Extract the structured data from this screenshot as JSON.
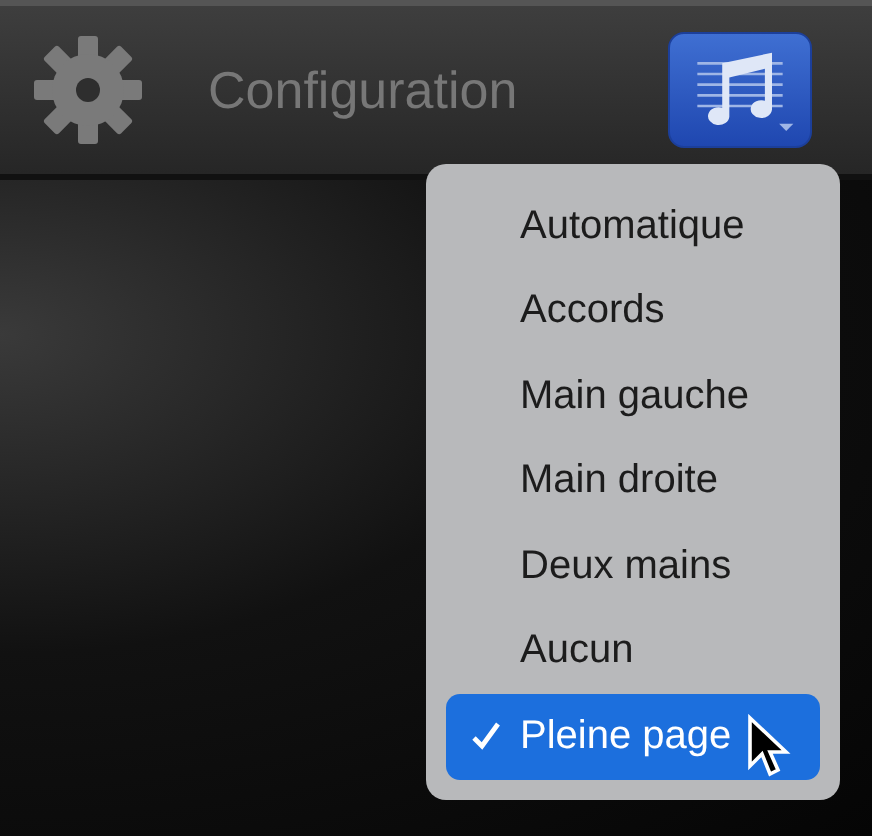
{
  "toolbar": {
    "title": "Configuration"
  },
  "menu": {
    "items": [
      {
        "label": "Automatique",
        "selected": false
      },
      {
        "label": "Accords",
        "selected": false
      },
      {
        "label": "Main gauche",
        "selected": false
      },
      {
        "label": "Main droite",
        "selected": false
      },
      {
        "label": "Deux mains",
        "selected": false
      },
      {
        "label": "Aucun",
        "selected": false
      },
      {
        "label": "Pleine page",
        "selected": true
      }
    ]
  }
}
